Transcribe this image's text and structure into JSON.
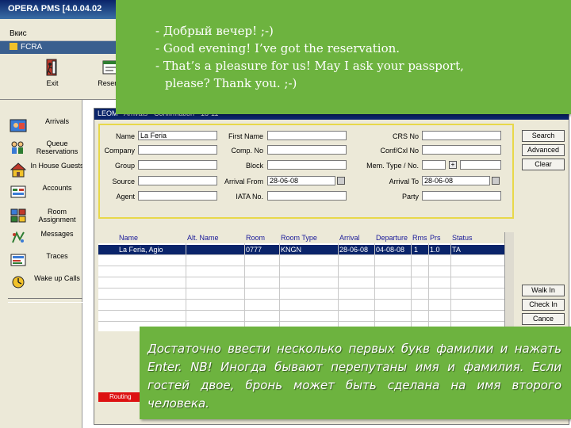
{
  "window": {
    "title": "OPERA PMS [4.0.04.02"
  },
  "menubar": {
    "item": "Вкис"
  },
  "subbar": {
    "label": "FCRA"
  },
  "toolbar": {
    "exit_label": "Exit",
    "reservation_label": "Reserva"
  },
  "leftnav": {
    "items": [
      {
        "label": "Arrivals",
        "icon": "arrivals-icon"
      },
      {
        "label": "Queue Reservations",
        "icon": "queue-icon"
      },
      {
        "label": "In House Guests",
        "icon": "in-house-icon"
      },
      {
        "label": "Accounts",
        "icon": "accounts-icon"
      },
      {
        "label": "Room Assignment",
        "icon": "room-assignment-icon"
      },
      {
        "label": "Messages",
        "icon": "messages-icon"
      },
      {
        "label": "Traces",
        "icon": "traces-icon"
      },
      {
        "label": "Wake up Calls",
        "icon": "wake-up-icon"
      }
    ]
  },
  "panel": {
    "title": "LEOM - Arrivals - Confirmation - 18-11"
  },
  "search": {
    "name_label": "Name",
    "name_value": "La Feria",
    "company_label": "Company",
    "group_label": "Group",
    "source_label": "Source",
    "agent_label": "Agent",
    "first_name_label": "First Name",
    "comp_no_label": "Comp. No",
    "block_label": "Block",
    "arrival_from_label": "Arrival From",
    "arrival_from_value": "28-06-08",
    "iata_label": "IATA No.",
    "crs_label": "CRS No",
    "conf_label": "Conf/Cxl No",
    "member_label": "Mem. Type / No.",
    "arrival_to_label": "Arrival To",
    "arrival_to_value": "28-06-08",
    "party_label": "Party",
    "plus_symbol": "+"
  },
  "buttons": {
    "search": "Search",
    "advanced": "Advanced",
    "clear": "Clear",
    "walk_in": "Walk In",
    "check_in": "Check In",
    "cancel": "Cance"
  },
  "grid": {
    "headers": [
      "Name",
      "Alt. Name",
      "Room",
      "Room Type",
      "Arrival",
      "Departure",
      "Rms",
      "Prs",
      "Status"
    ],
    "rows": [
      {
        "name": "La Feria, Agio",
        "alt": "",
        "room": "0777",
        "room_type": "KNGN",
        "arrival": "28-06-08",
        "departure": "04-08-08",
        "rms": "1",
        "prs": "1.0",
        "status": "TA"
      }
    ]
  },
  "redbar": {
    "label": "Routing"
  },
  "notes": {
    "top_lines": [
      "- Добрый вечер! ;-)",
      "- Good evening! I’ve got the reservation.",
      "- That’s a pleasure for us! May I ask your passport,",
      "please? Thank you. ;-)"
    ],
    "bottom_text": "Достаточно ввести несколько первых букв фамилии и нажать Enter. NB! Иногда бывают перепутаны имя и фамилия. Если гостей двое, бронь может быть сделана на имя второго человека."
  },
  "colors": {
    "note_green": "#6db33f",
    "selected_row": "#0a246a",
    "search_border": "#e8d84a"
  }
}
